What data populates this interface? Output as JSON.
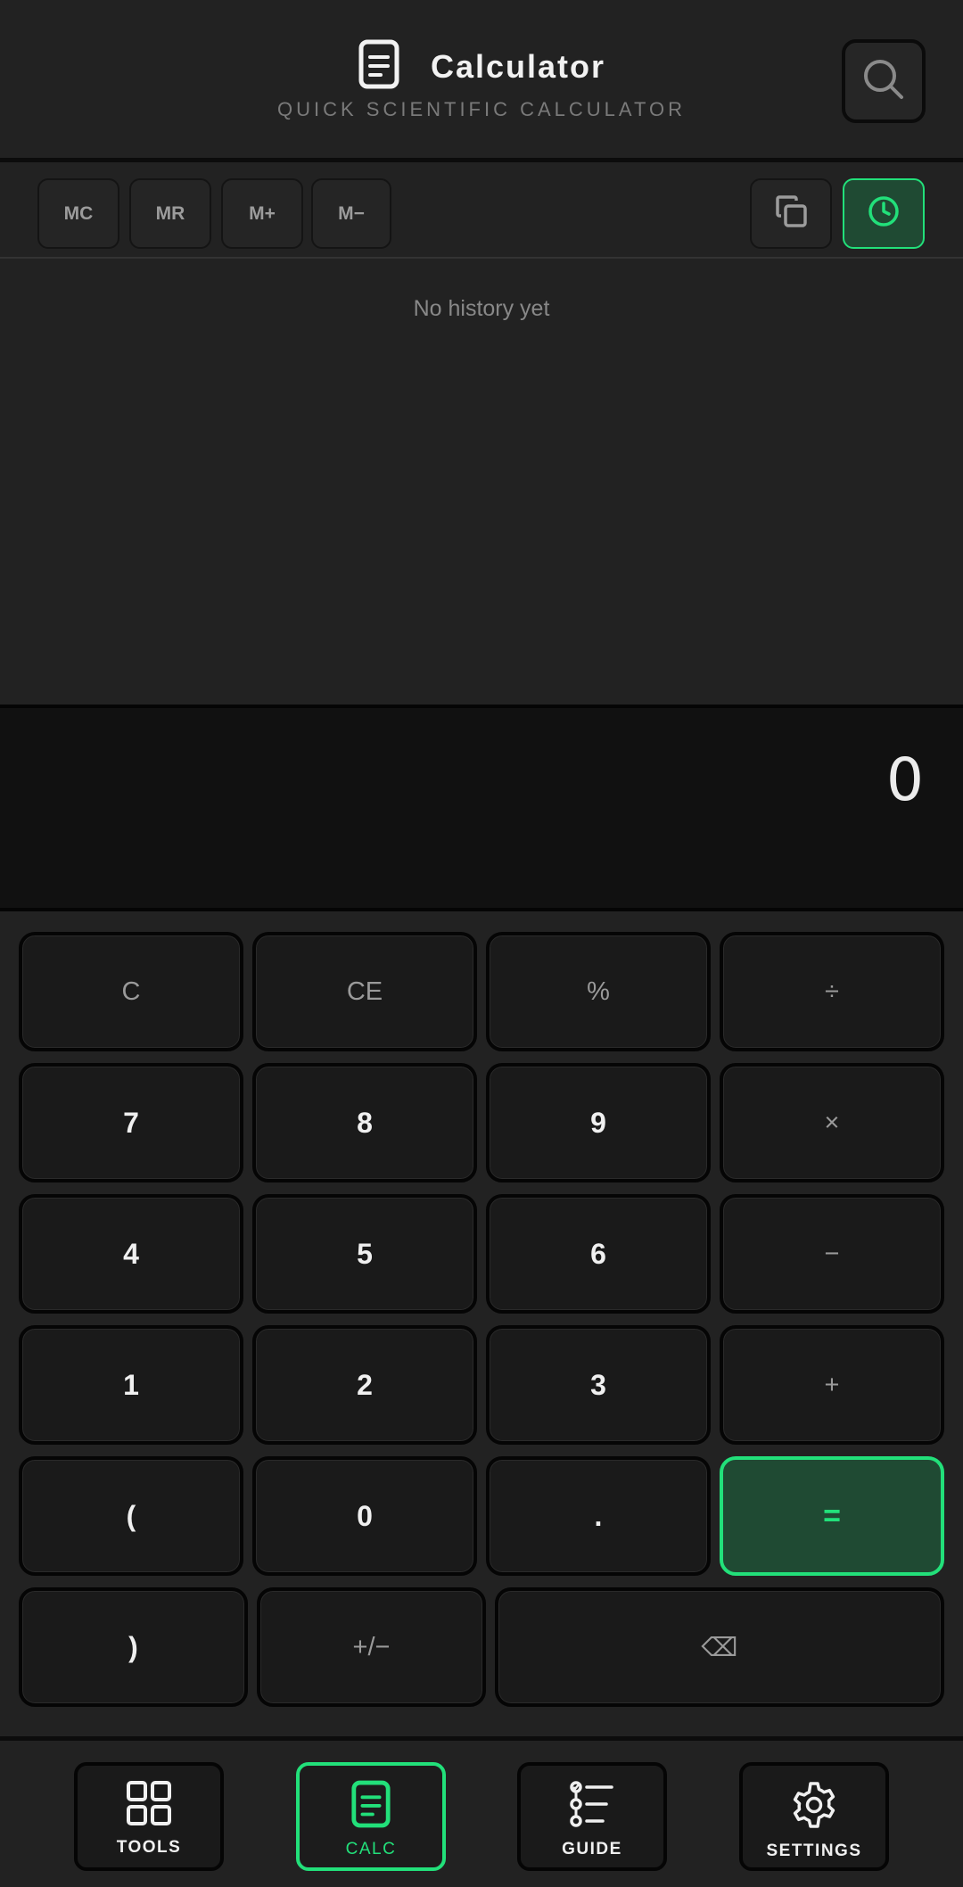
{
  "header": {
    "title": "Calculator",
    "subtitle": "QUICK SCIENTIFIC CALCULATOR",
    "icon": "document-icon",
    "search_icon": "search-icon"
  },
  "memory": {
    "buttons": [
      "MC",
      "MR",
      "M+",
      "M−"
    ],
    "copy_icon": "copy-icon",
    "history_icon": "clock-icon"
  },
  "history": {
    "empty_text": "No history yet"
  },
  "display": {
    "value": "0"
  },
  "keypad": {
    "row1": [
      "C",
      "CE",
      "%",
      "÷"
    ],
    "row2": [
      "7",
      "8",
      "9",
      "×"
    ],
    "row3": [
      "4",
      "5",
      "6",
      "−"
    ],
    "row4": [
      "1",
      "2",
      "3",
      "+"
    ],
    "row5": [
      "(",
      "0",
      ".",
      "="
    ],
    "row6": [
      ")",
      "+/−",
      "⌫"
    ]
  },
  "nav": {
    "items": [
      {
        "label": "TOOLS",
        "icon": "grid-icon"
      },
      {
        "label": "CALC",
        "icon": "document-icon",
        "active": true
      },
      {
        "label": "GUIDE",
        "icon": "list-icon"
      },
      {
        "label": "SETTINGS",
        "icon": "gear-icon"
      }
    ]
  },
  "colors": {
    "accent": "#22e07a",
    "background": "#222222",
    "display": "#111111"
  }
}
